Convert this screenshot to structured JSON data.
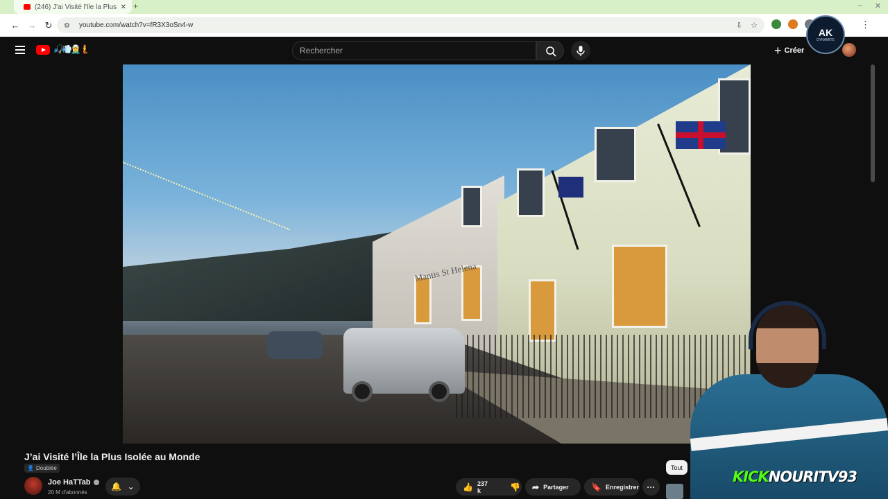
{
  "browser": {
    "tab_title": "(246) J'ai Visité l'Île la Plus ...",
    "url": "youtube.com/watch?v=fR3X3oSn4-w"
  },
  "youtube": {
    "search_placeholder": "Rechercher",
    "create_label": "Créer",
    "logo_emoji": "🎣💨🧝‍♂️🧜"
  },
  "overlay": {
    "ak_badge": "AK",
    "ak_badge_sub": "DYNAMITE",
    "kick_brand": "KICK",
    "kick_channel": "NOURITV93"
  },
  "video": {
    "sign_text": "Mantis St Helena",
    "title": "J’ai Visité l’Île la Plus Isolée au Monde",
    "dubbed_label": "Doublée"
  },
  "channel": {
    "name": "Joe HaTTab",
    "subscribers": "20 M d'abonnés"
  },
  "actions": {
    "likes": "237 k",
    "share": "Partager",
    "save": "Enregistrer",
    "more": "···"
  },
  "chips": {
    "all": "Tout"
  },
  "icons": [
    "back-icon",
    "forward-icon",
    "reload-icon",
    "site-settings-icon",
    "install-icon",
    "bookmark-star-icon",
    "menu-icon",
    "search-icon",
    "mic-icon",
    "plus-icon",
    "bell-icon",
    "chevron-down-icon",
    "like-icon",
    "dislike-icon",
    "share-icon",
    "save-icon",
    "more-icon",
    "verified-icon"
  ],
  "colors": {
    "youtube_red": "#ff0000",
    "kick_green": "#53fc18",
    "tabbar_bg": "#d8f0c8"
  }
}
